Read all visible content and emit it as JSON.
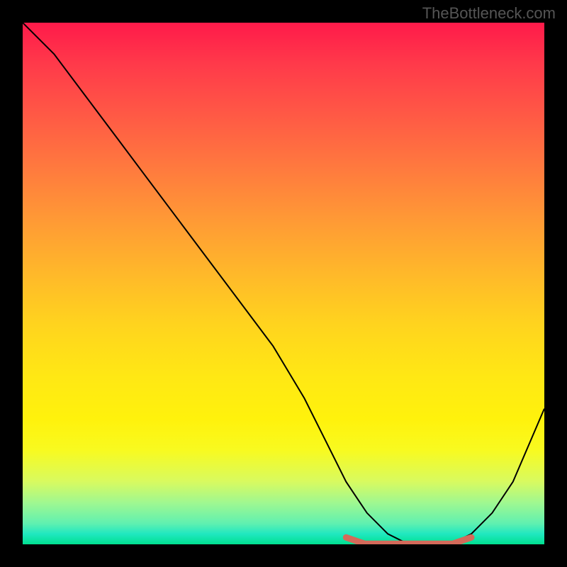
{
  "watermark": "TheBottleneck.com",
  "chart_data": {
    "type": "line",
    "title": "",
    "xlabel": "",
    "ylabel": "",
    "xlim": [
      0,
      100
    ],
    "ylim": [
      0,
      100
    ],
    "series": [
      {
        "name": "bottleneck-curve",
        "x": [
          0,
          6,
          12,
          18,
          24,
          30,
          36,
          42,
          48,
          54,
          58,
          62,
          66,
          70,
          74,
          78,
          82,
          86,
          90,
          94,
          100
        ],
        "y": [
          100,
          94,
          86,
          78,
          70,
          62,
          54,
          46,
          38,
          28,
          20,
          12,
          6,
          2,
          0,
          0,
          0,
          2,
          6,
          12,
          26
        ]
      }
    ],
    "sweet_spot": {
      "x_start": 62,
      "x_end": 86,
      "y": 0.5
    },
    "gradient_stops": [
      {
        "pos": 0,
        "color": "#ff1a4a"
      },
      {
        "pos": 50,
        "color": "#ffd41e"
      },
      {
        "pos": 80,
        "color": "#fff20c"
      },
      {
        "pos": 100,
        "color": "#00e090"
      }
    ]
  }
}
